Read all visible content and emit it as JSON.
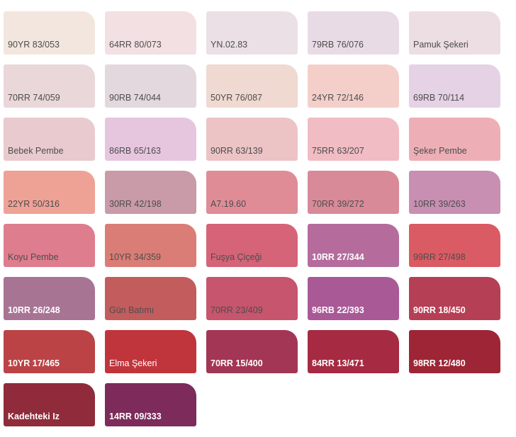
{
  "swatches": [
    {
      "name": "90YR 83/053",
      "color": "#f3e6de",
      "text": "light"
    },
    {
      "name": "64RR 80/073",
      "color": "#f3e0e2",
      "text": "light"
    },
    {
      "name": "YN.02.83",
      "color": "#ebe0e5",
      "text": "light"
    },
    {
      "name": "79RB 76/076",
      "color": "#e9dbe5",
      "text": "light"
    },
    {
      "name": "Pamuk Şekeri",
      "color": "#ecdee2",
      "text": "light"
    },
    {
      "name": "70RR 74/059",
      "color": "#ead7d9",
      "text": "light"
    },
    {
      "name": "90RB 74/044",
      "color": "#e3d8de",
      "text": "light"
    },
    {
      "name": "50YR 76/087",
      "color": "#f0d9d0",
      "text": "light"
    },
    {
      "name": "24YR 72/146",
      "color": "#f4cfc9",
      "text": "light"
    },
    {
      "name": "69RB 70/114",
      "color": "#e5d2e4",
      "text": "light"
    },
    {
      "name": "Bebek Pembe",
      "color": "#e9cacf",
      "text": "light"
    },
    {
      "name": "86RB 65/163",
      "color": "#e6c6df",
      "text": "light"
    },
    {
      "name": "90RR 63/139",
      "color": "#ecc4c6",
      "text": "light"
    },
    {
      "name": "75RR 63/207",
      "color": "#f1bcc4",
      "text": "light"
    },
    {
      "name": "Şeker Pembe",
      "color": "#edafb5",
      "text": "light"
    },
    {
      "name": "22YR 50/316",
      "color": "#eea296",
      "text": "light"
    },
    {
      "name": "30RR 42/198",
      "color": "#c99aa8",
      "text": "light"
    },
    {
      "name": "A7.19.60",
      "color": "#df8c96",
      "text": "light"
    },
    {
      "name": "70RR 39/272",
      "color": "#d88a99",
      "text": "light"
    },
    {
      "name": "10RR 39/263",
      "color": "#c88fb2",
      "text": "light"
    },
    {
      "name": "Koyu Pembe",
      "color": "#de7d8e",
      "text": "light"
    },
    {
      "name": "10YR 34/359",
      "color": "#d97d76",
      "text": "light"
    },
    {
      "name": "Fuşya Çiçeği",
      "color": "#d56478",
      "text": "light"
    },
    {
      "name": "10RR 27/344",
      "color": "#b56c9c",
      "text": "dark",
      "bold": true
    },
    {
      "name": "99RR 27/498",
      "color": "#da5b63",
      "text": "light"
    },
    {
      "name": "10RR 26/248",
      "color": "#a87494",
      "text": "dark",
      "bold": true
    },
    {
      "name": "Gün Batımı",
      "color": "#c25c5d",
      "text": "light"
    },
    {
      "name": "70RR 23/409",
      "color": "#c6556d",
      "text": "light"
    },
    {
      "name": "96RB 22/393",
      "color": "#a95996",
      "text": "dark",
      "bold": true
    },
    {
      "name": "90RR 18/450",
      "color": "#b53f55",
      "text": "dark",
      "bold": true
    },
    {
      "name": "10YR 17/465",
      "color": "#bb4345",
      "text": "dark",
      "bold": true
    },
    {
      "name": "Elma Şekeri",
      "color": "#c0353c",
      "text": "dark"
    },
    {
      "name": "70RR 15/400",
      "color": "#a23654",
      "text": "dark",
      "bold": true
    },
    {
      "name": "84RR 13/471",
      "color": "#a62a42",
      "text": "dark",
      "bold": true
    },
    {
      "name": "98RR 12/480",
      "color": "#9d2535",
      "text": "dark",
      "bold": true
    },
    {
      "name": "Kadehteki Iz",
      "color": "#8f2b3a",
      "text": "dark",
      "bold": true
    },
    {
      "name": "14RR 09/333",
      "color": "#7c2b5a",
      "text": "dark",
      "bold": true
    }
  ]
}
